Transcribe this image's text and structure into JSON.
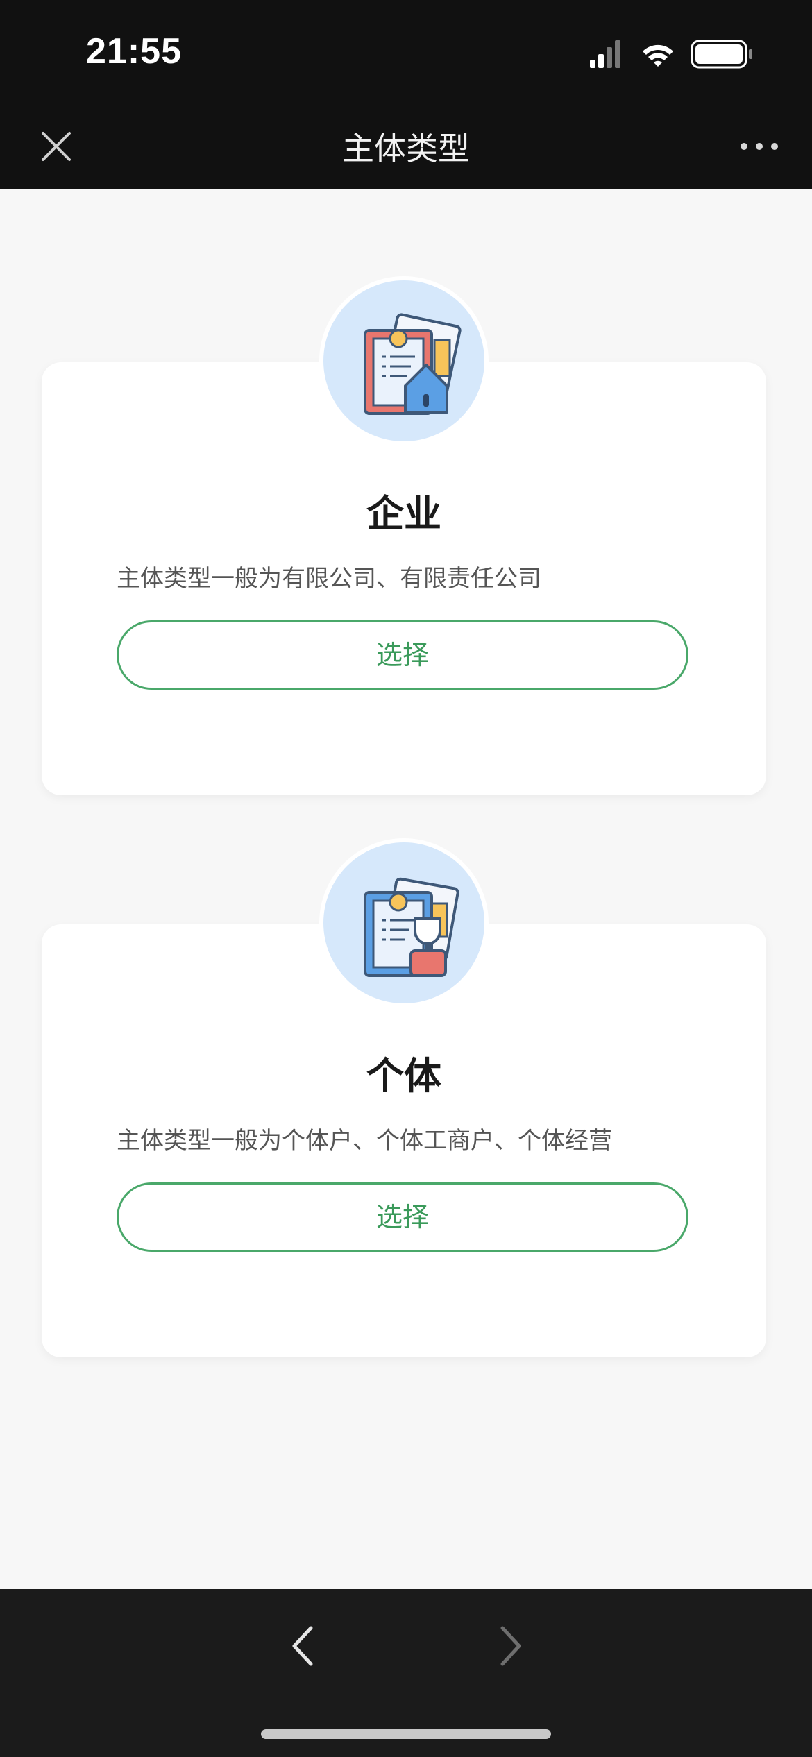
{
  "status_bar": {
    "time": "21:55",
    "icons": [
      "signal-icon",
      "wifi-icon",
      "battery-icon"
    ]
  },
  "nav": {
    "title": "主体类型",
    "close_icon": "close-icon",
    "more_icon": "more-icon"
  },
  "cards": [
    {
      "icon": "enterprise-icon",
      "title": "企业",
      "description": "主体类型一般为有限公司、有限责任公司",
      "button_label": "选择"
    },
    {
      "icon": "individual-icon",
      "title": "个体",
      "description": "主体类型一般为个体户、个体工商户、个体经营",
      "button_label": "选择"
    }
  ],
  "bottom_bar": {
    "back_icon": "back-arrow-icon",
    "forward_icon": "forward-arrow-icon"
  },
  "colors": {
    "accent": "#4aa86a",
    "header_bg": "#111111",
    "page_bg": "#f7f7f7",
    "icon_circle": "#d6e8fb"
  }
}
